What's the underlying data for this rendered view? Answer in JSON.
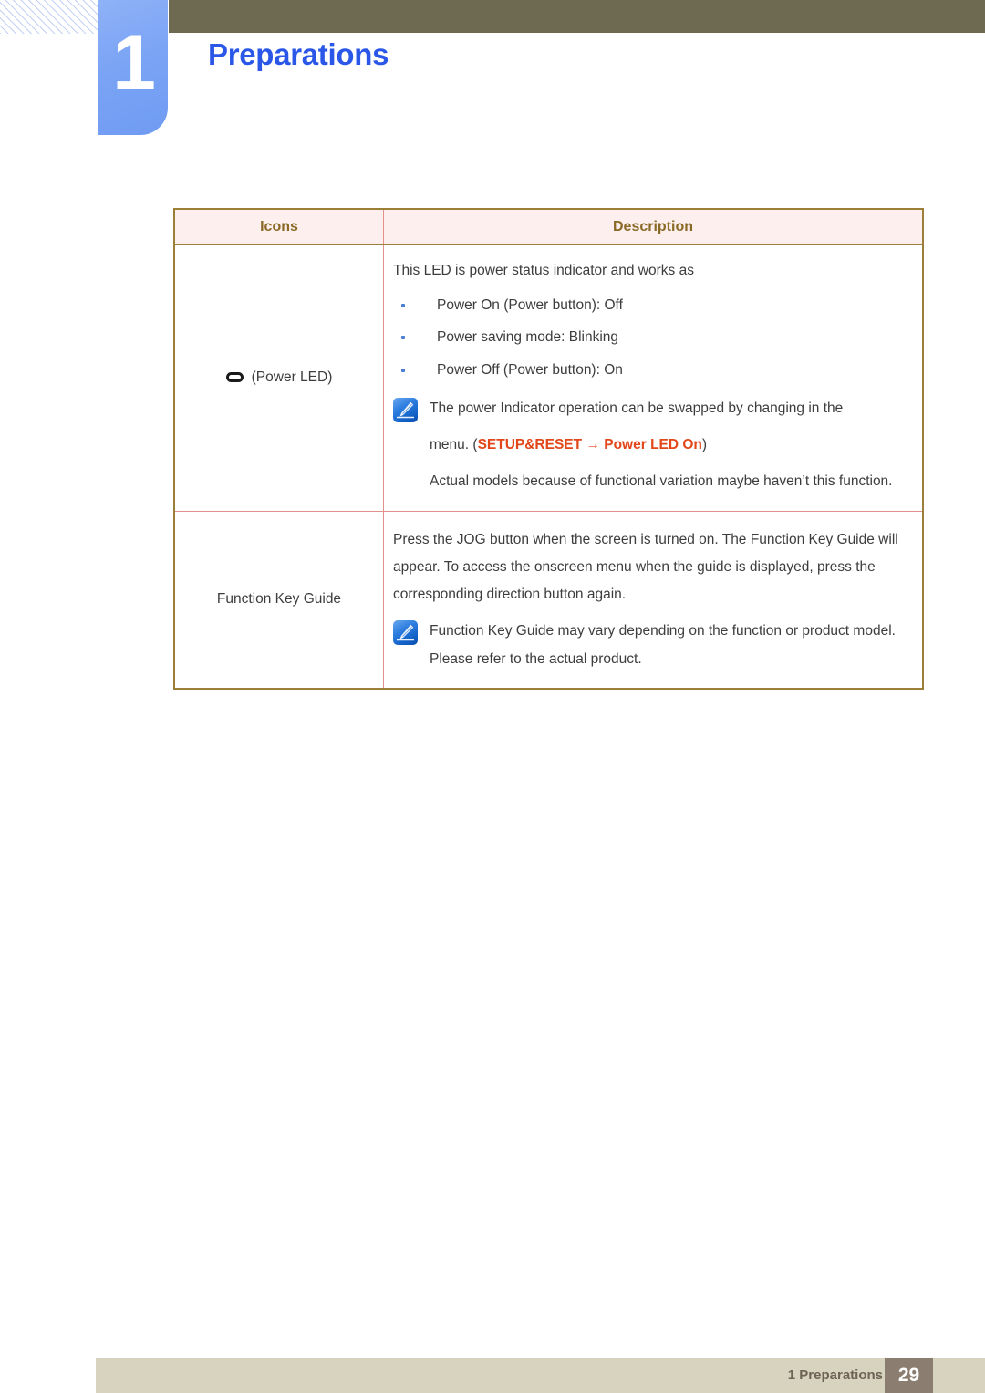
{
  "header": {
    "chapter_number": "1",
    "chapter_title": "Preparations",
    "accent_color": "#2a57e8",
    "tab_color": "#7ba4f5",
    "bar_color": "#6e6a51"
  },
  "table": {
    "columns": [
      "Icons",
      "Description"
    ],
    "rows": [
      {
        "icon_label": "(Power LED)",
        "icon_glyph": "power-led-pill-icon",
        "lead": "This LED is power status indicator and works as",
        "bullets": [
          "Power On (Power button): Off",
          "Power saving mode: Blinking",
          "Power Off (Power button): On"
        ],
        "note": {
          "icon": "note-pencil-icon",
          "line1_a": "The power Indicator operation can be swapped by changing in the",
          "line2_pre": "menu. (",
          "line2_hl1": "SETUP&RESET",
          "line2_arrow": "→",
          "line2_hl2": "Power LED On",
          "line2_post": ")",
          "line3": "Actual models because of functional variation maybe haven’t this function."
        }
      },
      {
        "icon_label": "Function Key Guide",
        "paragraph": "Press the JOG button when the screen is turned on. The Function Key Guide will appear. To access the onscreen menu when the guide is displayed, press the corresponding direction button again.",
        "note": {
          "icon": "note-pencil-icon",
          "text": "Function Key Guide may vary depending on the function or product model. Please refer to the actual product."
        }
      }
    ],
    "header_bg": "#fcefee",
    "header_text_color": "#8a6a26",
    "border_color": "#9b7f38",
    "inner_border_color": "#e3918a"
  },
  "footer": {
    "label": "1 Preparations",
    "page_number": "29",
    "bar_color": "#d8d3bf",
    "page_box_color": "#8b7d6f"
  }
}
